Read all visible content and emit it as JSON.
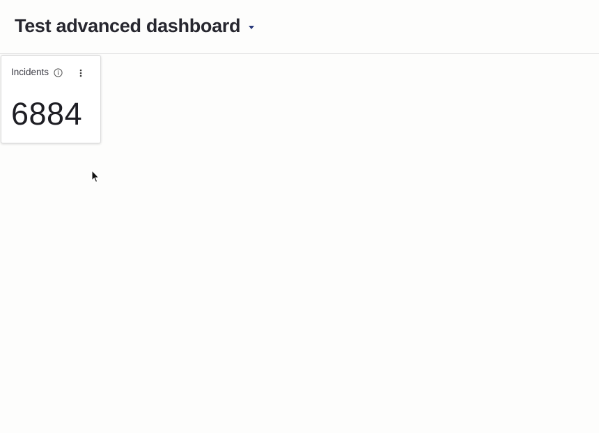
{
  "header": {
    "dashboard_title": "Test advanced dashboard",
    "dropdown_icon": "caret-down-icon"
  },
  "widgets": [
    {
      "title": "Incidents",
      "value": "6884",
      "info_icon": "info-icon",
      "menu_icon": "more-vertical-icon"
    }
  ],
  "colors": {
    "background": "#fdfdfc",
    "title_text": "#27272f",
    "caret_accent": "#2a3a7c",
    "widget_border": "#dcdcdc",
    "divider": "#dedede"
  }
}
